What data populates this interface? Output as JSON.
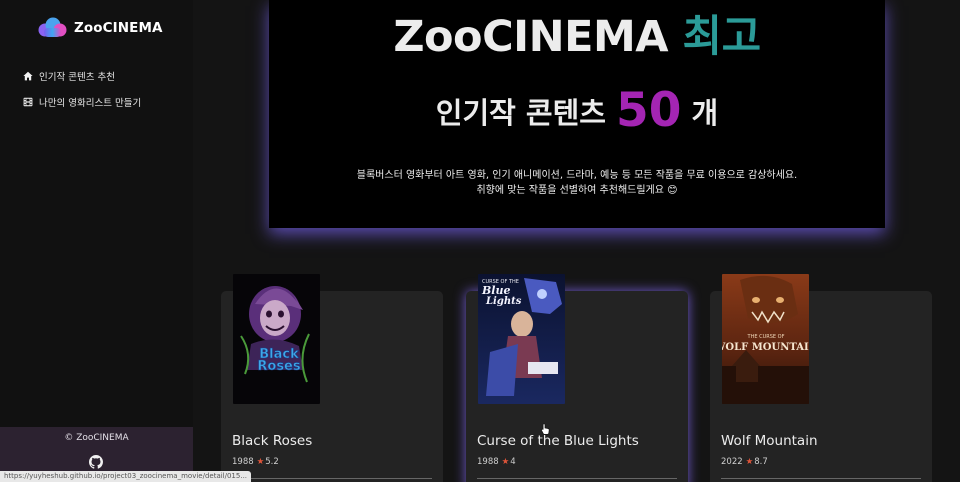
{
  "app": {
    "name": "ZooCINEMA"
  },
  "sidebar": {
    "nav": [
      {
        "label": "인기작 콘텐츠 추천",
        "icon": "home-icon"
      },
      {
        "label": "나만의 영화리스트 만들기",
        "icon": "film-icon"
      }
    ],
    "footer": {
      "copyright": "© ZooCINEMA",
      "icon": "github-icon"
    }
  },
  "hero": {
    "title_main": "ZooCINEMA ",
    "title_accent": "최고",
    "subtitle_pre": "인기작 콘텐츠 ",
    "subtitle_num": "50",
    "subtitle_post": " 개",
    "desc_line1": "블록버스터 영화부터 아트 영화, 인기 애니메이션, 드라마, 예능 등 모든 작품을 무료 이용으로 감상하세요.",
    "desc_line2": "취향에 맞는 작품을 선별하여 추천해드릴게요 😊"
  },
  "movies": [
    {
      "title": "Black Roses",
      "year": "1988",
      "rating": "5.2",
      "poster_text": "Black Roses"
    },
    {
      "title": "Curse of the Blue Lights",
      "year": "1988",
      "rating": "4",
      "poster_text": "CURSE OF THE Blue Lights"
    },
    {
      "title": "Wolf Mountain",
      "year": "2022",
      "rating": "8.7",
      "poster_text": "THE CURSE OF WOLF MOUNTAIN"
    }
  ],
  "status_bar": {
    "url": "https://yuyheshub.github.io/project03_zoocinema_movie/detail/015..."
  },
  "colors": {
    "accent_teal": "#2b9b98",
    "accent_purple": "#a425b3",
    "glow": "#7360e6",
    "star": "#e0553a"
  }
}
